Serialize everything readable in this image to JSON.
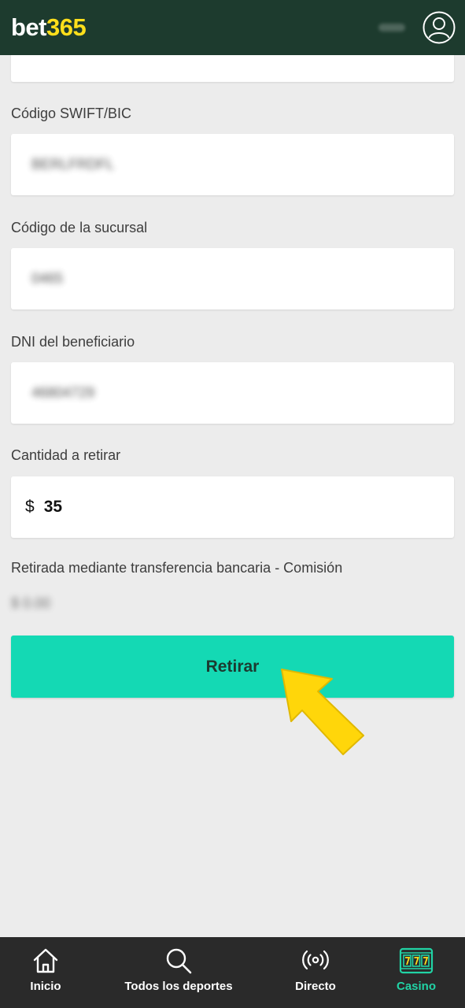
{
  "header": {
    "logo_main": "bet",
    "logo_number": "365"
  },
  "form": {
    "swift": {
      "label": "Código SWIFT/BIC",
      "value": "BERLFRDFL"
    },
    "branch": {
      "label": "Código de la sucursal",
      "value": "0465"
    },
    "dni": {
      "label": "DNI del beneficiario",
      "value": "46804729"
    },
    "amount": {
      "label": "Cantidad a retirar",
      "currency": "$",
      "value": "35"
    },
    "fee": {
      "label": "Retirada mediante transferencia bancaria - Comisión",
      "value": "$ 0.00"
    },
    "submit_label": "Retirar"
  },
  "bottom_nav": {
    "items": [
      {
        "label": "Inicio",
        "icon": "home-icon"
      },
      {
        "label": "Todos los deportes",
        "icon": "search-icon"
      },
      {
        "label": "Directo",
        "icon": "live-broadcast-icon"
      },
      {
        "label": "Casino",
        "icon": "slot-machine-icon",
        "active": true
      }
    ]
  },
  "colors": {
    "header_bg": "#1d3b2e",
    "logo_accent": "#ffdf1b",
    "button_bg": "#14d9b4",
    "nav_bg": "#2a2a2a",
    "active_nav": "#21d3a5",
    "arrow": "#ffd60a"
  }
}
